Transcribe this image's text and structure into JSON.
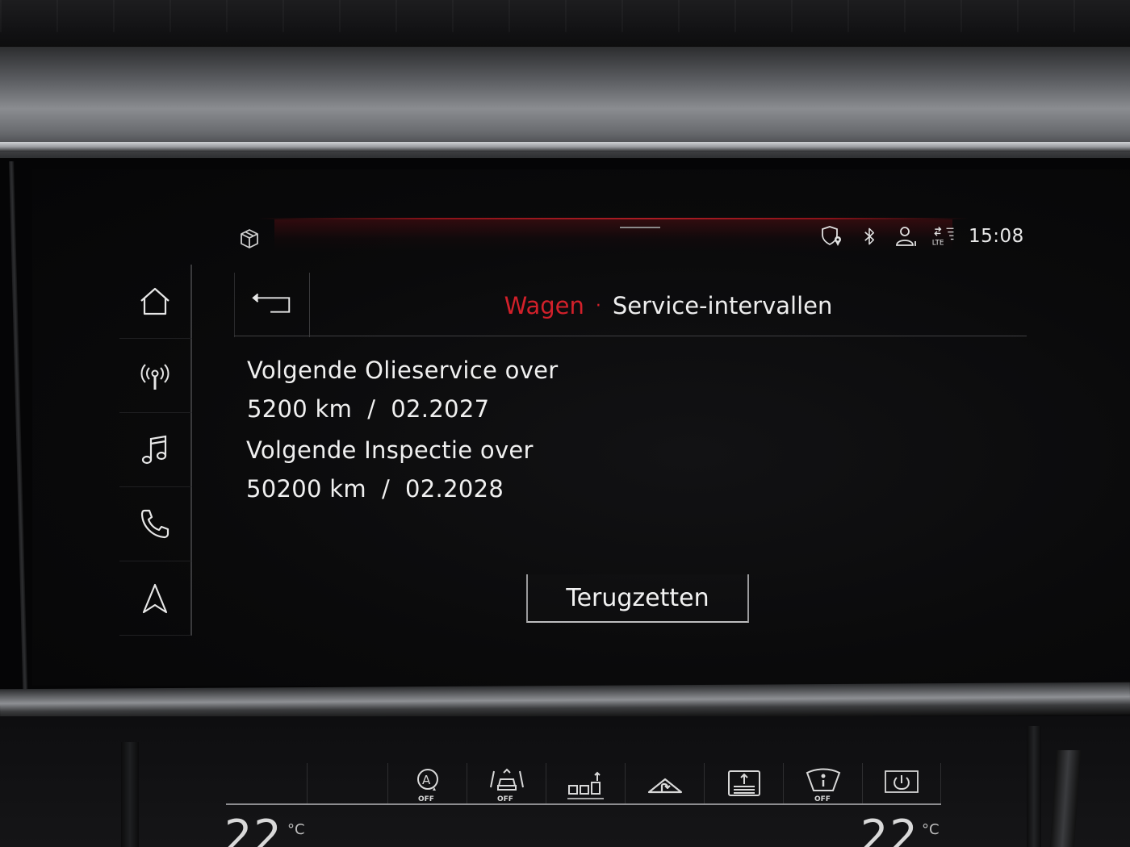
{
  "status_bar": {
    "time": "15:08",
    "icons": [
      "box-icon",
      "location-shield-icon",
      "bluetooth-icon",
      "user-profile-icon",
      "lte-icon"
    ]
  },
  "nav_rail": {
    "items": [
      {
        "icon": "home-icon"
      },
      {
        "icon": "radio-icon"
      },
      {
        "icon": "music-icon"
      },
      {
        "icon": "phone-icon"
      },
      {
        "icon": "navigation-icon"
      }
    ]
  },
  "header": {
    "back_icon": "back-arrow-icon",
    "breadcrumb_parent": "Wagen",
    "breadcrumb_separator": "·",
    "breadcrumb_current": "Service-intervallen"
  },
  "service": {
    "oil_label": "Volgende Olieservice over",
    "oil_value": "5200 km  /  02.2027",
    "inspection_label": "Volgende Inspectie over",
    "inspection_value": "50200 km  /  02.2028"
  },
  "reset_button_label": "Terugzetten",
  "climate": {
    "buttons": [
      {
        "icon": "auto-climate-off-icon",
        "label": "OFF"
      },
      {
        "icon": "car-recirculation-off-icon",
        "label": "OFF"
      },
      {
        "icon": "seat-heating-icon"
      },
      {
        "icon": "recirculation-icon"
      },
      {
        "icon": "defrost-rear-icon"
      },
      {
        "icon": "windshield-info-off-icon",
        "label": "OFF"
      },
      {
        "icon": "power-icon"
      }
    ],
    "temp_unit": "°C"
  },
  "colors": {
    "accent_red": "#d2202a",
    "text": "#f0f0f0",
    "background": "#0a0a0b"
  }
}
